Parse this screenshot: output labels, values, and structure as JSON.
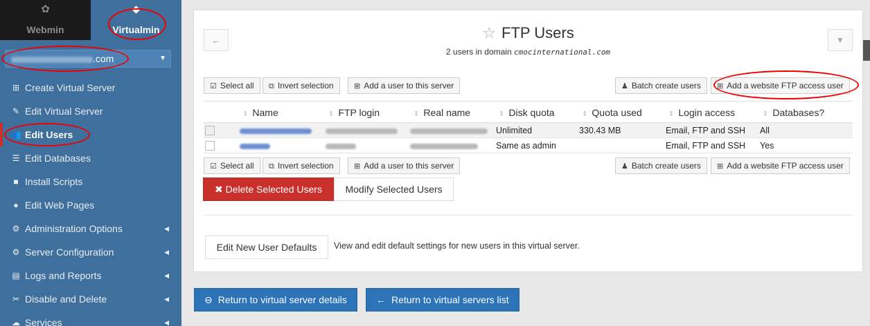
{
  "switcher": {
    "webmin_label": "Webmin",
    "virtualmin_label": "Virtualmin"
  },
  "domain_select": {
    "suffix": ".com"
  },
  "menu": [
    {
      "label": "Create Virtual Server",
      "icon": "plus-square-icon"
    },
    {
      "label": "Edit Virtual Server",
      "icon": "edit-icon"
    },
    {
      "label": "Edit Users",
      "icon": "users-icon"
    },
    {
      "label": "Edit Databases",
      "icon": "database-icon"
    },
    {
      "label": "Install Scripts",
      "icon": "scripts-icon"
    },
    {
      "label": "Edit Web Pages",
      "icon": "globe-icon"
    },
    {
      "label": "Administration Options",
      "icon": "gear-icon"
    },
    {
      "label": "Server Configuration",
      "icon": "gears-icon"
    },
    {
      "label": "Logs and Reports",
      "icon": "file-icon"
    },
    {
      "label": "Disable and Delete",
      "icon": "plug-icon"
    },
    {
      "label": "Services",
      "icon": "cloud-icon"
    }
  ],
  "page": {
    "title": "FTP Users",
    "subtitle_prefix": "2 users in domain",
    "subtitle_domain": "cmocinternational.com"
  },
  "toolbar": {
    "select_all": "Select all",
    "invert_selection": "Invert selection",
    "add_user": "Add a user to this server",
    "batch_create": "Batch create users",
    "add_website_ftp": "Add a website FTP access user"
  },
  "table": {
    "columns": [
      "Name",
      "FTP login",
      "Real name",
      "Disk quota",
      "Quota used",
      "Login access",
      "Databases?"
    ],
    "rows": [
      {
        "disk_quota": "Unlimited",
        "quota_used": "330.43 MB",
        "login_access": "Email, FTP and SSH",
        "databases": "All"
      },
      {
        "disk_quota": "Same as admin",
        "quota_used": "",
        "login_access": "Email, FTP and SSH",
        "databases": "Yes"
      }
    ]
  },
  "actions": {
    "delete_selected": "Delete Selected Users",
    "modify_selected": "Modify Selected Users",
    "edit_defaults": "Edit New User Defaults",
    "defaults_desc": "View and edit default settings for new users in this virtual server."
  },
  "footer": {
    "return_details": "Return to virtual server details",
    "return_list": "Return to virtual servers list"
  },
  "colors": {
    "sidebar_bg": "#3f6f9c",
    "danger": "#c9302c",
    "primary": "#2d73b8"
  }
}
